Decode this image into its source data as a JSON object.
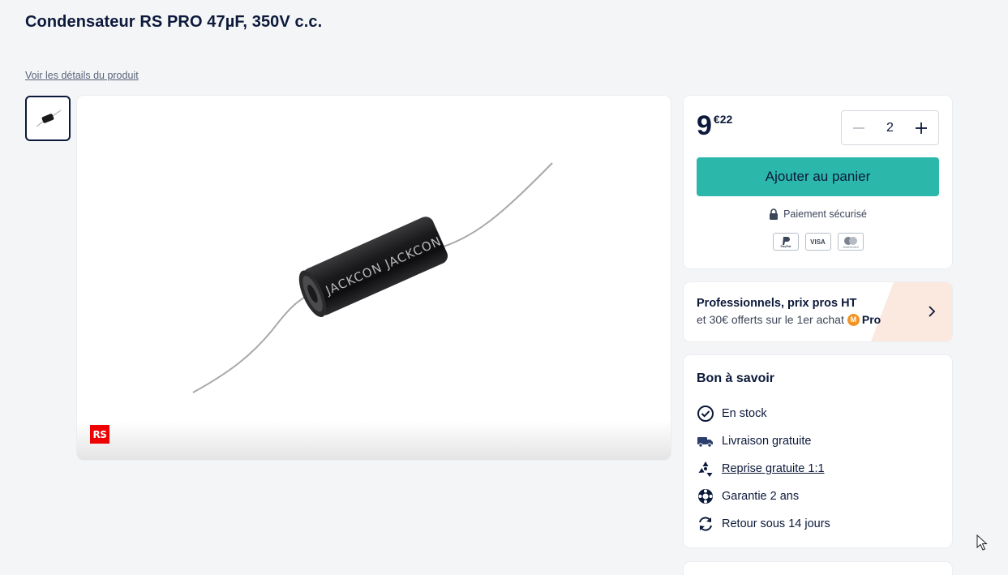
{
  "product": {
    "title": "Condensateur RS PRO 47µF, 350V c.c.",
    "details_link": "Voir les détails du produit",
    "image_logo": "RS",
    "capacitor_label": "JACKCON"
  },
  "buy_box": {
    "price_int": "9",
    "price_dec": "€22",
    "quantity": "2",
    "add_to_cart": "Ajouter au panier",
    "secure_payment": "Paiement sécurisé",
    "payment_methods": [
      "PayPal",
      "VISA",
      "mastercard"
    ]
  },
  "pro": {
    "title": "Professionnels, prix pros HT",
    "subtitle": "et 30€ offerts sur le 1er achat",
    "badge_letter": "M",
    "badge": "Pro"
  },
  "good_to_know": {
    "title": "Bon à savoir",
    "items": [
      {
        "label": "En stock",
        "icon": "check-circle-icon"
      },
      {
        "label": "Livraison gratuite",
        "icon": "truck-icon"
      },
      {
        "label": "Reprise gratuite 1:1",
        "icon": "recycle-icon"
      },
      {
        "label": "Garantie 2 ans",
        "icon": "lifebuoy-icon"
      },
      {
        "label": "Retour sous 14 jours",
        "icon": "return-icon"
      }
    ]
  },
  "colors": {
    "accent": "#2bb8ab",
    "text": "#0c193a",
    "pro_orange": "#f39325",
    "background": "#f4f5f7"
  }
}
